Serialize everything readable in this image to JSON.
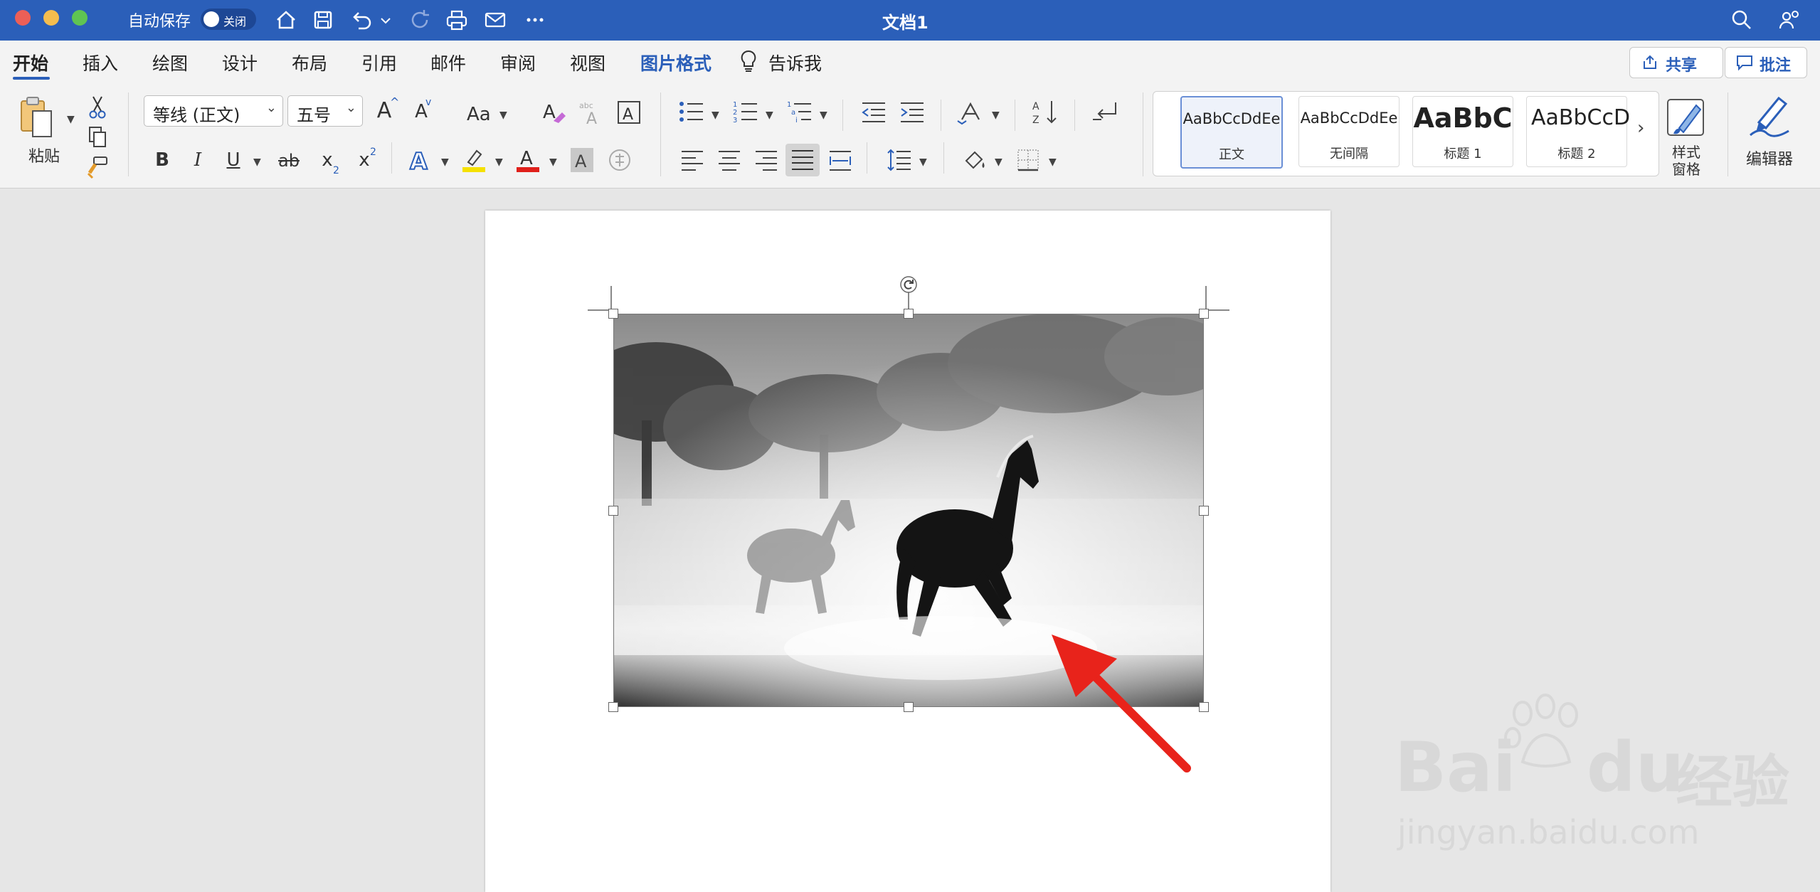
{
  "titlebar": {
    "autosave_label": "自动保存",
    "autosave_toggle": "关闭",
    "doc_title": "文档1"
  },
  "tabs": [
    {
      "label": "开始",
      "active": true
    },
    {
      "label": "插入"
    },
    {
      "label": "绘图"
    },
    {
      "label": "设计"
    },
    {
      "label": "布局"
    },
    {
      "label": "引用"
    },
    {
      "label": "邮件"
    },
    {
      "label": "审阅"
    },
    {
      "label": "视图"
    },
    {
      "label": "图片格式",
      "contextual": true
    },
    {
      "label": "告诉我"
    }
  ],
  "actions": {
    "share": "共享",
    "comments": "批注"
  },
  "ribbon": {
    "paste_label": "粘贴",
    "font_name": "等线 (正文)",
    "font_size": "五号",
    "case_label": "Aa",
    "bold": "B",
    "italic": "I",
    "underline": "U",
    "strike": "ab",
    "sub": "x",
    "sup": "x",
    "grow": "A",
    "shrink": "A",
    "styles": [
      {
        "sample": "AaBbCcDdEe",
        "name": "正文",
        "selected": true
      },
      {
        "sample": "AaBbCcDdEe",
        "name": "无间隔"
      },
      {
        "sample": "AaBbC",
        "name": "标题 1"
      },
      {
        "sample": "AaBbCcD",
        "name": "标题 2"
      }
    ],
    "styles_pane_label": "样式\n窗格",
    "editor_label": "编辑器"
  },
  "colors": {
    "accent": "#2b5fb9",
    "highlight": "#f5e100",
    "font_color": "#e0201b",
    "arrow": "#e8231b"
  },
  "watermark": {
    "brand": "Bai",
    "brand_tail": "du",
    "cn": "经验",
    "url": "jingyan.baidu.com"
  }
}
